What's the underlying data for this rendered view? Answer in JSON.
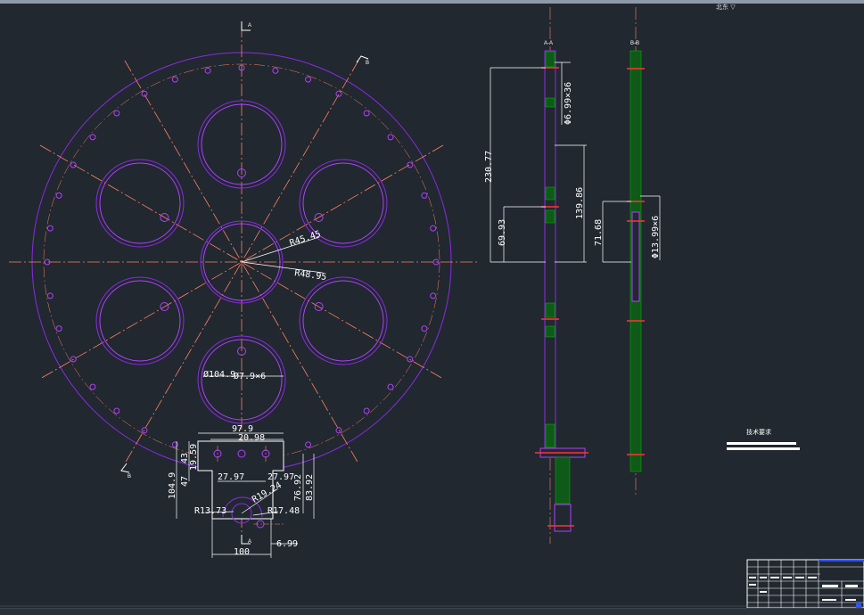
{
  "viewport": {
    "corner_label": "北东 ▽"
  },
  "colors": {
    "background": "#212830",
    "outline": "#8a2be2",
    "hole": "#b040ff",
    "center_line": "#ff8060",
    "dimension": "#ffffff",
    "hatch": "#00b000",
    "accent": "#ff3333",
    "title_block": "#3050ff"
  },
  "section_labels": {
    "a_top": "A",
    "a_bottom": "A",
    "b_top": "B",
    "b_bottom": "B",
    "section_aa": "A-A",
    "section_bb": "B-B"
  },
  "dimensions": {
    "r45_45": "R45.45",
    "r48_95": "R48.95",
    "dia104_9": "Ø104.9",
    "dia_small_holes": "Ø7.9×6",
    "d97_9": "97.9",
    "d20_98": "20.98",
    "d43": "43",
    "d19_59": "19.59",
    "d47": "47",
    "d104_9": "104.9",
    "d27_97_a": "27.97",
    "d27_97_b": "27.97",
    "d76_92": "76.92",
    "d83_92": "83.92",
    "r19_24": "R19.24",
    "r13_73": "R13.73",
    "r17_48": "R17.48",
    "d100": "100",
    "d6_99": "6.99",
    "d230_77": "230.77",
    "d139_86": "139.86",
    "d69_93": "69.93",
    "phi6_99x36": "Φ6.99×36",
    "d71_68": "71.68",
    "phi13_99x6": "Φ13.99×6"
  },
  "notes": {
    "heading": "技术要求"
  }
}
